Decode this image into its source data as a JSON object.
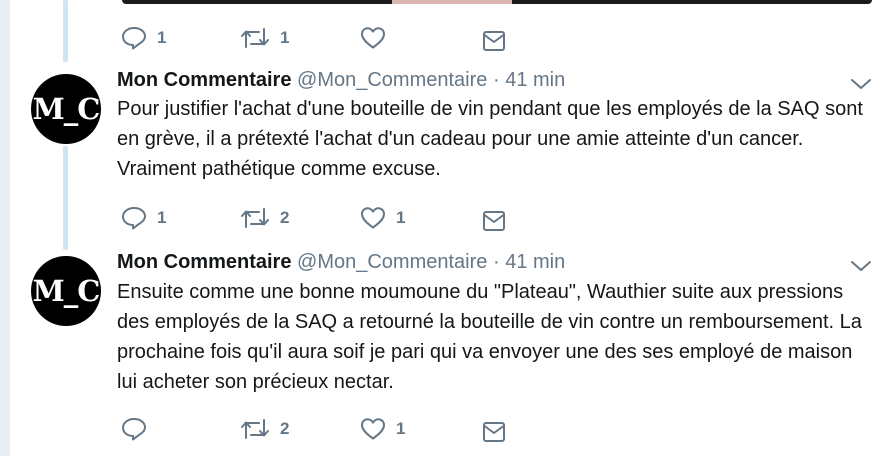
{
  "thread": {
    "previous_actions": {
      "replies": "1",
      "retweets": "1",
      "likes": ""
    },
    "tweets": [
      {
        "avatar_text": "M_C",
        "name": "Mon Commentaire",
        "handle": "@Mon_Commentaire",
        "separator": "·",
        "time": "41 min",
        "text": "Pour justifier l'achat d'une bouteille de vin pendant que les employés de la SAQ sont en grève, il a prétexté l'achat d'un cadeau pour une amie atteinte d'un cancer. Vraiment pathétique comme excuse.",
        "replies": "1",
        "retweets": "2",
        "likes": "1"
      },
      {
        "avatar_text": "M_C",
        "name": "Mon Commentaire",
        "handle": "@Mon_Commentaire",
        "separator": "·",
        "time": "41 min",
        "text": "Ensuite comme une bonne moumoune du \"Plateau\", Wauthier suite aux pressions des employés de la SAQ a retourné la bouteille de vin contre un remboursement. La prochaine fois qu'il aura soif je pari qui va envoyer une des ses employé de maison lui acheter son précieux nectar.",
        "replies": "",
        "retweets": "2",
        "likes": "1"
      }
    ]
  },
  "colors": {
    "text": "#14171a",
    "muted": "#657786",
    "thread_line": "#cfe5f4",
    "avatar_bg": "#000000"
  },
  "icons": [
    "reply-icon",
    "retweet-icon",
    "like-icon",
    "message-icon",
    "chevron-down-icon"
  ]
}
